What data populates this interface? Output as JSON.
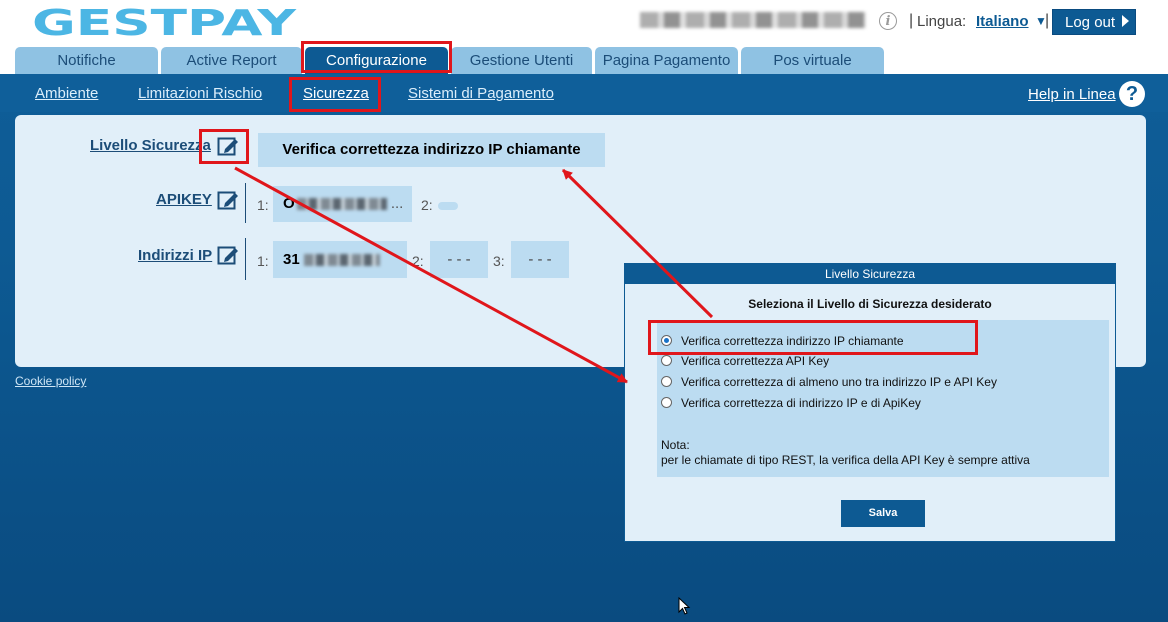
{
  "header": {
    "logo_text": "GESTPAY",
    "lingua_label": "Lingua:",
    "lingua_value": "Italiano",
    "logout_label": "Log out",
    "separator": "|"
  },
  "tabs": [
    {
      "label": "Notifiche"
    },
    {
      "label": "Active Report"
    },
    {
      "label": "Configurazione",
      "active": true
    },
    {
      "label": "Gestione Utenti"
    },
    {
      "label": "Pagina Pagamento"
    },
    {
      "label": "Pos virtuale"
    }
  ],
  "subnav": {
    "items": [
      {
        "label": "Ambiente"
      },
      {
        "label": "Limitazioni Rischio"
      },
      {
        "label": "Sicurezza",
        "active": true
      },
      {
        "label": "Sistemi di Pagamento"
      }
    ],
    "help_label": "Help in Linea",
    "help_glyph": "?"
  },
  "security": {
    "level_label": "Livello Sicurezza",
    "level_value": "Verifica correttezza indirizzo IP chiamante",
    "apikey_label": "APIKEY",
    "apikey_1_prefix": "O",
    "apikey_1_suffix": "...",
    "ip_label": "Indirizzi IP",
    "ip_1_prefix": "31",
    "ip_empty": "- - -",
    "idx_1": "1:",
    "idx_2": "2:",
    "idx_3": "3:"
  },
  "cookie_label": "Cookie policy",
  "dialog": {
    "title": "Livello Sicurezza",
    "subtitle": "Seleziona il Livello di Sicurezza desiderato",
    "options": [
      {
        "label": "Verifica correttezza indirizzo IP chiamante",
        "selected": true
      },
      {
        "label": "Verifica correttezza API Key",
        "selected": false
      },
      {
        "label": "Verifica correttezza di almeno uno tra indirizzo IP e API Key",
        "selected": false
      },
      {
        "label": "Verifica correttezza di indirizzo IP e di ApiKey",
        "selected": false
      }
    ],
    "note_title": "Nota:",
    "note_text": "per le chiamate di tipo REST, la verifica della API Key è sempre attiva",
    "save_label": "Salva"
  },
  "colors": {
    "brand_blue": "#0d5a93",
    "tab_light": "#8fc2e3",
    "logo_cyan": "#4cb6e4",
    "highlight_red": "#e0161b"
  }
}
